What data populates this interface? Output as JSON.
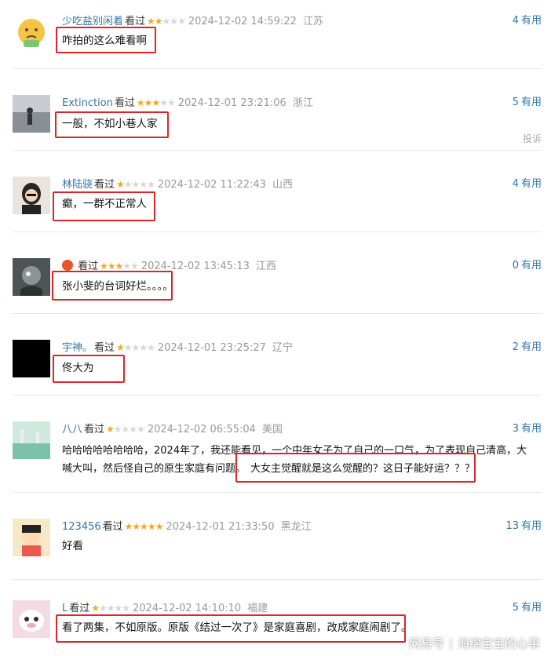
{
  "comments": [
    {
      "user": "少吃盐别闲着",
      "watched": "看过",
      "stars": 2,
      "time": "2024-12-02 14:59:22",
      "location": "江苏",
      "useful_count": "4",
      "useful_label": "有用",
      "text": "咋拍的这么难看啊"
    },
    {
      "user": "Extinction",
      "watched": "看过",
      "stars": 3,
      "time": "2024-12-01 23:21:06",
      "location": "浙江",
      "useful_count": "5",
      "useful_label": "有用",
      "text": "一般，不如小巷人家",
      "report": "投诉"
    },
    {
      "user": "林陆骁",
      "watched": "看过",
      "stars": 1,
      "time": "2024-12-02 11:22:43",
      "location": "山西",
      "useful_count": "4",
      "useful_label": "有用",
      "text": "癫，一群不正常人"
    },
    {
      "user": "",
      "watched": "看过",
      "stars": 3,
      "time": "2024-12-02 13:45:13",
      "location": "江西",
      "useful_count": "0",
      "useful_label": "有用",
      "text": "张小斐的台词好烂。。。。"
    },
    {
      "user": "宇神。",
      "watched": "看过",
      "stars": 1,
      "time": "2024-12-01 23:25:27",
      "location": "辽宁",
      "useful_count": "2",
      "useful_label": "有用",
      "text": "佟大为"
    },
    {
      "user": "八八",
      "watched": "看过",
      "stars": 1,
      "time": "2024-12-02 06:55:04",
      "location": "美国",
      "useful_count": "3",
      "useful_label": "有用",
      "text_line1": "哈哈哈哈哈哈哈哈，2024年了，我还能看见，一个中年女子为了自己的一口气，为了表现自己清高，大",
      "text_line2_a": "喊大叫，然后怪自己的原生家庭有问题。",
      "text_line2_b": "大女主觉醒就是这么觉醒的？这日子能好运？？？"
    },
    {
      "user": "123456",
      "watched": "看过",
      "stars": 5,
      "time": "2024-12-01 21:33:50",
      "location": "黑龙江",
      "useful_count": "13",
      "useful_label": "有用",
      "text": "好看"
    },
    {
      "user": "L",
      "watched": "看过",
      "stars": 1,
      "time": "2024-12-02 14:10:10",
      "location": "福建",
      "useful_count": "5",
      "useful_label": "有用",
      "text": "看了两集，不如原版。原版《结过一次了》是家庭喜剧，改成家庭闹剧了。"
    }
  ],
  "watermark": {
    "source": "网易号",
    "account": "海绵宝宝的心事"
  },
  "colors": {
    "highlight": "#d9262b",
    "link": "#3377aa",
    "star": "#f5a623"
  }
}
